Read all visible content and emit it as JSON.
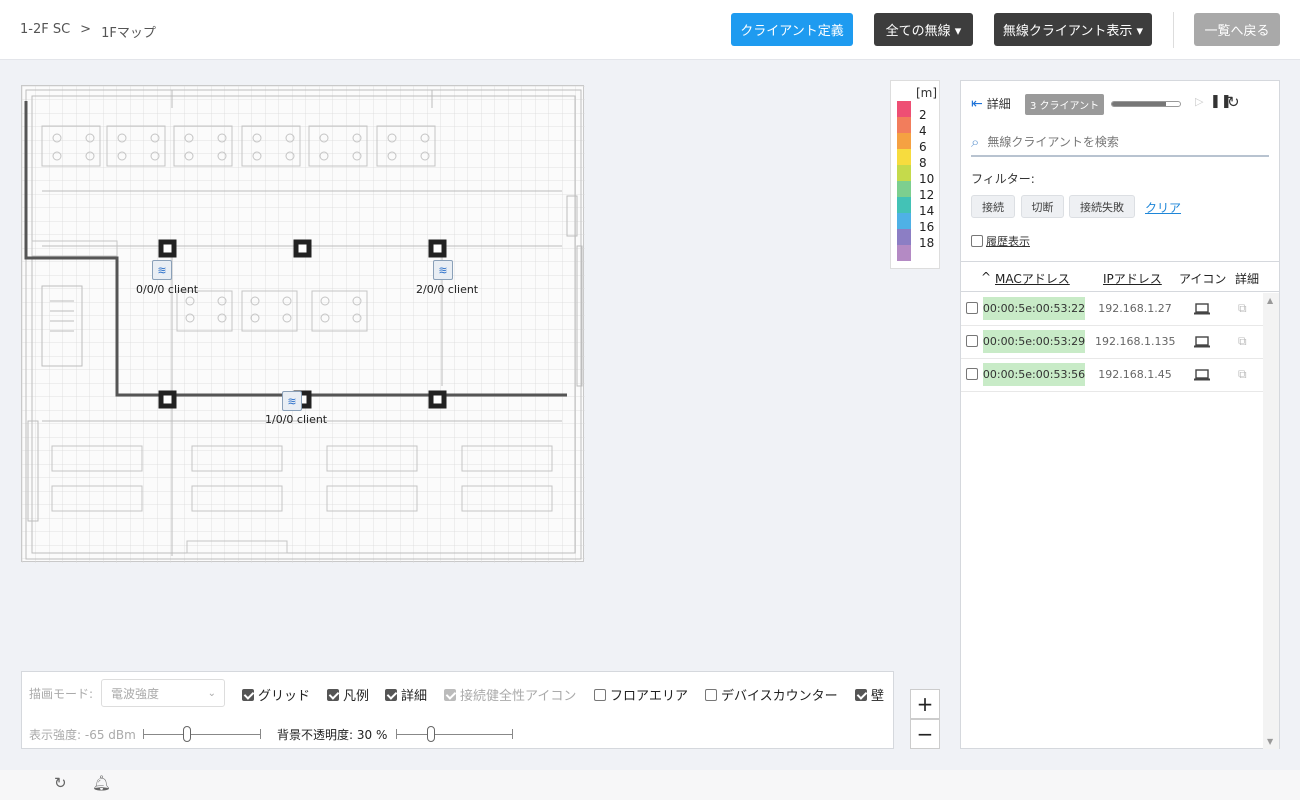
{
  "header": {
    "breadcrumb": [
      "1-2F SC",
      ">",
      "1Fマップ"
    ],
    "client_def_button": "クライアント定義",
    "all_wireless_button": "全ての無線 ▾",
    "wireless_client_display_button": "無線クライアント表示 ▾",
    "back_to_list_button": "一覧へ戻る",
    "accent_color": "#1e9bf0"
  },
  "map": {
    "aps": [
      {
        "label": "0/0/0 client"
      },
      {
        "label": "2/0/0 client"
      },
      {
        "label": "1/0/0 client"
      }
    ]
  },
  "legend": {
    "unit": "[m]",
    "items": [
      {
        "value": "2",
        "color": "#ee4f74"
      },
      {
        "value": "4",
        "color": "#f27d5c"
      },
      {
        "value": "6",
        "color": "#f5a142"
      },
      {
        "value": "8",
        "color": "#f7dc3e"
      },
      {
        "value": "10",
        "color": "#c5da4b"
      },
      {
        "value": "12",
        "color": "#7dcf8f"
      },
      {
        "value": "14",
        "color": "#43c2b6"
      },
      {
        "value": "16",
        "color": "#4fb1e6"
      },
      {
        "value": "18",
        "color": "#8c7ec4"
      },
      {
        "value": "",
        "color": "#b48ac4"
      }
    ]
  },
  "panel": {
    "back_label": "詳細",
    "client_count_badge": "3 クライアント",
    "progress_fraction": 0.8,
    "search_placeholder": "無線クライアントを検索",
    "filter_label": "フィルター:",
    "filters": [
      "接続",
      "切断",
      "接続失敗"
    ],
    "clear_label": "クリア",
    "history_label": "履歴表示",
    "columns": {
      "sort_indicator": "^",
      "mac": "MACアドレス",
      "ip": "IPアドレス",
      "icon": "アイコン",
      "detail": "詳細"
    },
    "rows": [
      {
        "mac": "00:00:5e:00:53:22",
        "ip": "192.168.1.27"
      },
      {
        "mac": "00:00:5e:00:53:29",
        "ip": "192.168.1.135"
      },
      {
        "mac": "00:00:5e:00:53:56",
        "ip": "192.168.1.45"
      }
    ]
  },
  "toolbar": {
    "draw_mode_label": "描画モード:",
    "draw_mode_value": "電波強度",
    "grid_label": "グリッド",
    "legend_label": "凡例",
    "detail_label": "詳細",
    "health_icon_label": "接続健全性アイコン",
    "floor_area_label": "フロアエリア",
    "device_counter_label": "デバイスカウンター",
    "wall_label": "壁",
    "display_strength_label": "表示強度: -65 dBm",
    "display_strength_fraction": 0.37,
    "bg_opacity_label": "背景不透明度: 30 %",
    "bg_opacity_fraction": 0.3
  },
  "zoom": {
    "in": "+",
    "out": "−"
  },
  "footer": {
    "refresh_icon": "refresh-icon",
    "bell_icon": "bell-icon"
  }
}
